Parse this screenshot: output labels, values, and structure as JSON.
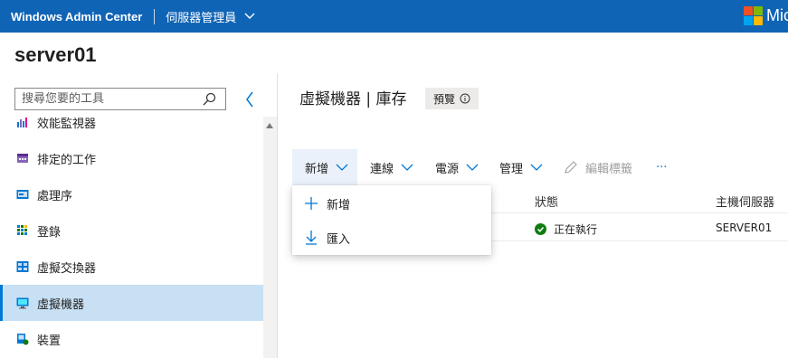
{
  "header": {
    "brand": "Windows Admin Center",
    "server_manager": "伺服器管理員",
    "ms_text": "Mic"
  },
  "server": {
    "name": "server01"
  },
  "sidebar": {
    "search_placeholder": "搜尋您要的工具",
    "items": [
      {
        "label": "效能監視器",
        "icon": "performance-icon"
      },
      {
        "label": "排定的工作",
        "icon": "scheduled-task-icon"
      },
      {
        "label": "處理序",
        "icon": "process-icon"
      },
      {
        "label": "登錄",
        "icon": "registry-icon"
      },
      {
        "label": "虛擬交換器",
        "icon": "virtual-switch-icon"
      },
      {
        "label": "虛擬機器",
        "icon": "virtual-machine-icon",
        "selected": true
      },
      {
        "label": "裝置",
        "icon": "devices-icon"
      }
    ]
  },
  "main": {
    "title": "虛擬機器 | 庫存",
    "preview_badge": "預覽",
    "toolbar": {
      "new": "新增",
      "connect": "連線",
      "power": "電源",
      "manage": "管理",
      "edit_tags": "編輯標籤",
      "more": "···"
    },
    "table": {
      "columns": [
        "狀態",
        "主機伺服器"
      ],
      "rows": [
        {
          "status": "正在執行",
          "host": "SERVER01"
        }
      ]
    },
    "new_menu": [
      {
        "label": "新增",
        "icon": "plus-icon"
      },
      {
        "label": "匯入",
        "icon": "import-icon"
      }
    ]
  },
  "colors": {
    "topbar": "#1064b6",
    "selected_nav": "#c7e0f4",
    "accent": "#0078d4",
    "status_running": "#107c10"
  }
}
